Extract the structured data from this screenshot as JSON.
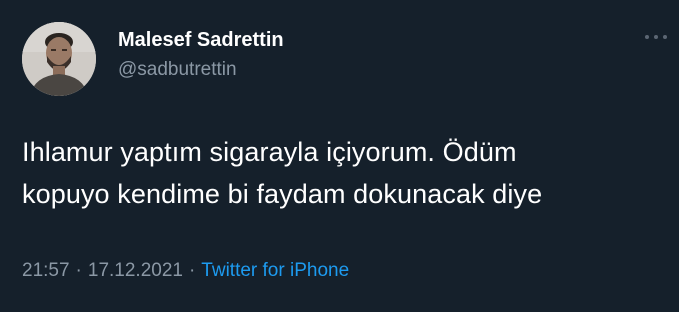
{
  "author": {
    "display_name": "Malesef Sadrettin",
    "handle": "@sadbutrettin"
  },
  "tweet": {
    "text_lines": [
      "Ihlamur yaptım sigarayla içiyorum. Ödüm",
      "kopuyo kendime bi faydam dokunacak diye"
    ]
  },
  "meta": {
    "time": "21:57",
    "separator": "·",
    "date": "17.12.2021",
    "source": "Twitter for iPhone"
  },
  "colors": {
    "background": "#15202b",
    "text": "#ffffff",
    "secondary": "#8b98a5",
    "link": "#1d9bf0"
  },
  "icons": {
    "more": "more-horizontal-icon",
    "avatar": "profile-photo"
  }
}
